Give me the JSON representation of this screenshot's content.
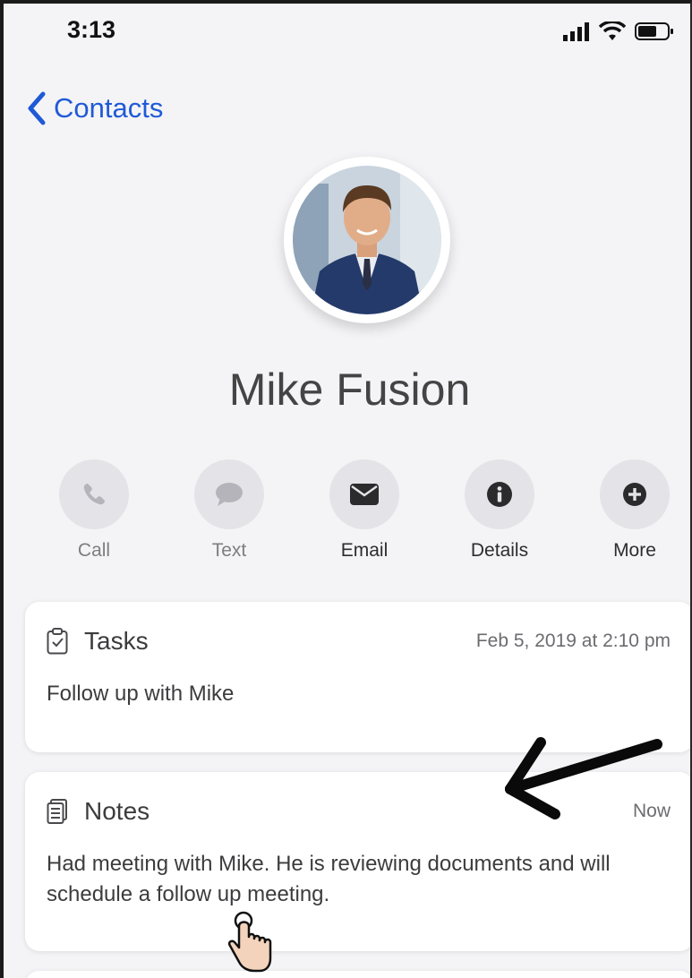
{
  "status_bar": {
    "time": "3:13"
  },
  "nav": {
    "back_label": "Contacts"
  },
  "contact": {
    "name": "Mike Fusion"
  },
  "actions": [
    {
      "label": "Call",
      "icon": "phone-icon"
    },
    {
      "label": "Text",
      "icon": "chat-bubble-icon"
    },
    {
      "label": "Email",
      "icon": "envelope-icon"
    },
    {
      "label": "Details",
      "icon": "info-icon"
    },
    {
      "label": "More",
      "icon": "plus-icon"
    }
  ],
  "tasks": {
    "title": "Tasks",
    "timestamp": "Feb 5, 2019 at 2:10 pm",
    "body": "Follow up with Mike",
    "icon": "clipboard-check-icon"
  },
  "notes": {
    "title": "Notes",
    "timestamp": "Now",
    "body": "Had meeting with Mike. He is reviewing documents and will schedule a follow up meeting.",
    "icon": "document-icon"
  },
  "colors": {
    "accent": "#1f5ad6",
    "action_circle": "#e4e4e8",
    "background": "#f4f4f6"
  }
}
